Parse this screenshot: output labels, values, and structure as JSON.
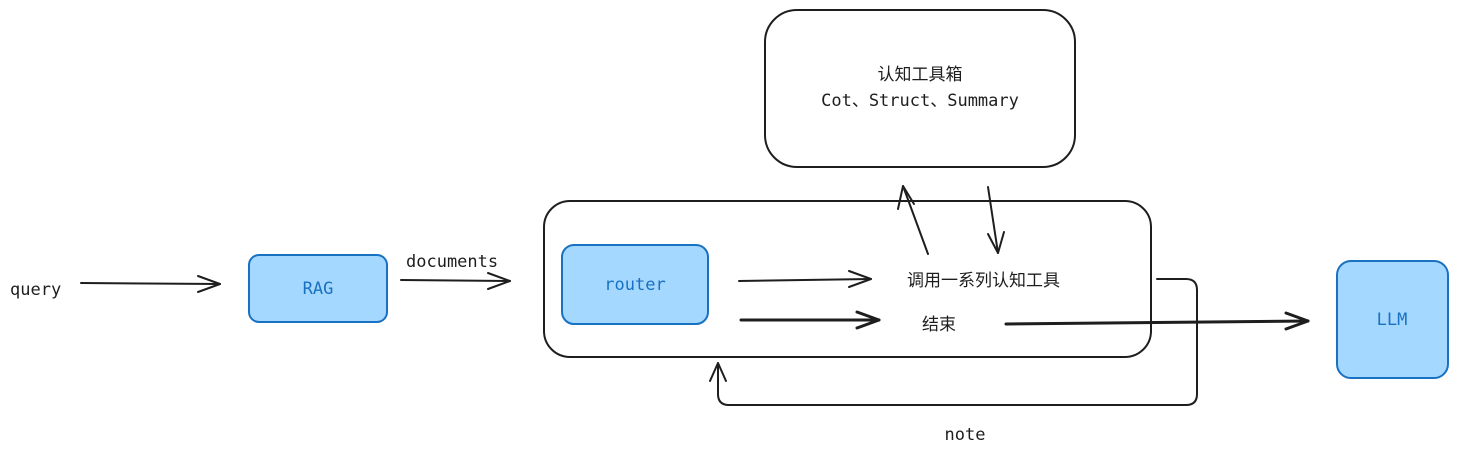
{
  "nodes": {
    "toolbox_title": "认知工具箱",
    "toolbox_tools": "Cot、Struct、Summary",
    "rag": "RAG",
    "router": "router",
    "llm": "LLM",
    "call_tools": "调用一系列认知工具",
    "finish": "结束"
  },
  "edges": {
    "query": "query",
    "documents": "documents",
    "note": "note"
  },
  "colors": {
    "node_fill": "#a5d8ff",
    "node_stroke": "#1971c2",
    "stroke": "#1e1e1e"
  }
}
